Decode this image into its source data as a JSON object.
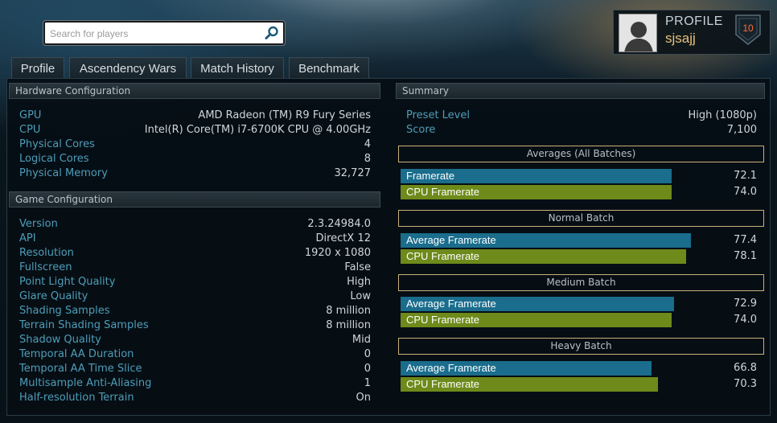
{
  "search": {
    "placeholder": "Search for players"
  },
  "profile": {
    "label": "PROFILE",
    "username": "sjsajj",
    "level": "10"
  },
  "tabs": [
    {
      "label": "Profile"
    },
    {
      "label": "Ascendency Wars"
    },
    {
      "label": "Match History"
    },
    {
      "label": "Benchmark"
    }
  ],
  "hardware": {
    "title": "Hardware Configuration",
    "rows": [
      {
        "key": "GPU",
        "value": "AMD Radeon (TM) R9 Fury Series"
      },
      {
        "key": "CPU",
        "value": "Intel(R) Core(TM) i7-6700K CPU @ 4.00GHz"
      },
      {
        "key": "Physical Cores",
        "value": "4"
      },
      {
        "key": "Logical Cores",
        "value": "8"
      },
      {
        "key": "Physical Memory",
        "value": "32,727"
      }
    ]
  },
  "game": {
    "title": "Game Configuration",
    "rows": [
      {
        "key": "Version",
        "value": "2.3.24984.0"
      },
      {
        "key": "API",
        "value": "DirectX 12"
      },
      {
        "key": "Resolution",
        "value": "1920 x 1080"
      },
      {
        "key": "Fullscreen",
        "value": "False"
      },
      {
        "key": "Point Light Quality",
        "value": "High"
      },
      {
        "key": "Glare Quality",
        "value": "Low"
      },
      {
        "key": "Shading Samples",
        "value": "8 million"
      },
      {
        "key": "Terrain Shading Samples",
        "value": "8 million"
      },
      {
        "key": "Shadow Quality",
        "value": "Mid"
      },
      {
        "key": "Temporal AA Duration",
        "value": "0"
      },
      {
        "key": "Temporal AA Time Slice",
        "value": "0"
      },
      {
        "key": "Multisample Anti-Aliasing",
        "value": "1"
      },
      {
        "key": "Half-resolution Terrain",
        "value": "On"
      }
    ]
  },
  "summary": {
    "title": "Summary",
    "preset_label": "Preset Level",
    "preset_value": "High (1080p)",
    "score_label": "Score",
    "score_value": "7,100",
    "batches": [
      {
        "title": "Averages (All Batches)",
        "bars": [
          {
            "label": "Framerate",
            "value": "72.1",
            "color": "#1a6d8c"
          },
          {
            "label": "CPU Framerate",
            "value": "74.0",
            "color": "#6d8a1a"
          }
        ]
      },
      {
        "title": "Normal Batch",
        "bars": [
          {
            "label": "Average Framerate",
            "value": "77.4",
            "color": "#1a6d8c"
          },
          {
            "label": "CPU Framerate",
            "value": "78.1",
            "color": "#6d8a1a"
          }
        ]
      },
      {
        "title": "Medium Batch",
        "bars": [
          {
            "label": "Average Framerate",
            "value": "72.9",
            "color": "#1a6d8c"
          },
          {
            "label": "CPU Framerate",
            "value": "74.0",
            "color": "#6d8a1a"
          }
        ]
      },
      {
        "title": "Heavy Batch",
        "bars": [
          {
            "label": "Average Framerate",
            "value": "66.8",
            "color": "#1a6d8c"
          },
          {
            "label": "CPU Framerate",
            "value": "70.3",
            "color": "#6d8a1a"
          }
        ]
      }
    ]
  }
}
